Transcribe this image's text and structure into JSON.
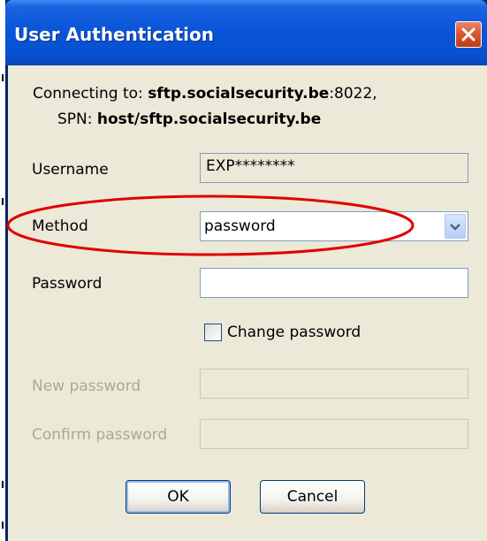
{
  "window": {
    "title": "User Authentication"
  },
  "connection": {
    "prefix": "Connecting to: ",
    "host": "sftp.socialsecurity.be",
    "port": ":8022,",
    "spn_prefix": "SPN: ",
    "spn": "host/sftp.socialsecurity.be"
  },
  "form": {
    "username_label": "Username",
    "username_value": "EXP********",
    "method_label": "Method",
    "method_value": "password",
    "password_label": "Password",
    "password_value": "",
    "change_password_label": "Change password",
    "change_password_checked": false,
    "new_password_label": "New password",
    "confirm_password_label": "Confirm password"
  },
  "buttons": {
    "ok": "OK",
    "cancel": "Cancel"
  },
  "colors": {
    "titlebar": "#0652d2",
    "close": "#d9542f",
    "dialog_bg": "#ece9d8",
    "annotation": "#e00000"
  },
  "icons": {
    "close": "close-icon",
    "dropdown": "chevron-down-icon"
  }
}
